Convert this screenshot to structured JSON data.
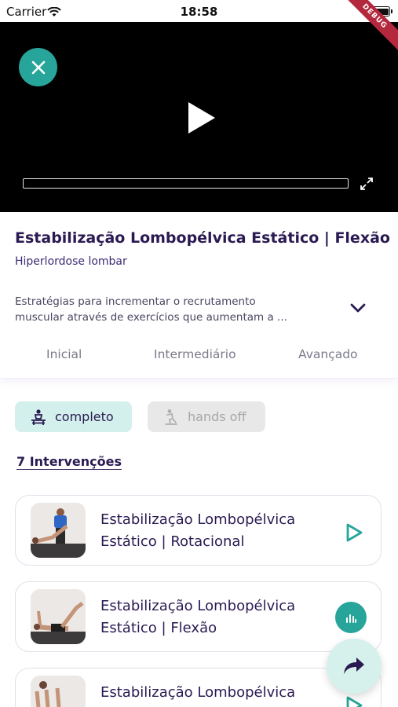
{
  "status_bar": {
    "carrier": "Carrier",
    "time": "18:58"
  },
  "debug_banner": "DEBUG",
  "exercise": {
    "title": "Estabilização Lombopélvica Estático | Flexão",
    "subtitle": "Hiperlordose lombar",
    "description_lines": [
      "Estratégias para incrementar o recrutamento",
      "muscular através de exercícios que aumentam a ..."
    ]
  },
  "tabs": [
    {
      "label": "Inicial"
    },
    {
      "label": "Intermediário"
    },
    {
      "label": "Avançado"
    }
  ],
  "modes": {
    "complete": {
      "label": "completo",
      "selected": true
    },
    "hands_off": {
      "label": "hands off",
      "selected": false
    }
  },
  "interventions_label": "7 Intervenções",
  "interventions": [
    {
      "line1": "Estabilização Lombopélvica",
      "line2": "Estático | Rotacional",
      "action_icon": "play-icon"
    },
    {
      "line1": "Estabilização Lombopélvica",
      "line2": "Estático | Flexão",
      "action_icon": "chart-icon"
    },
    {
      "line1": "Estabilização Lombopélvica",
      "line2": "",
      "action_icon": "play-icon"
    }
  ],
  "colors": {
    "accent": "#27a59a",
    "accent_light": "#d3f0ec",
    "primary_text": "#2a1a52",
    "debug": "#b4283e"
  }
}
